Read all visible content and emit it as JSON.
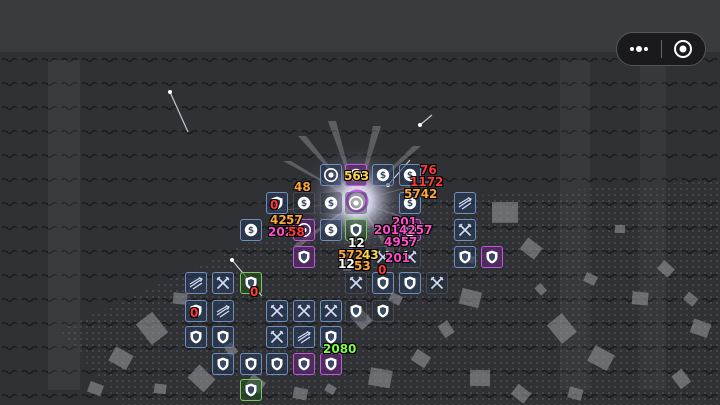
{
  "miniprogram_menu": {
    "more_icon": "more-dots-icon",
    "close_icon": "close-target-icon"
  },
  "colors": {
    "hit_purple": "#ff4fc8",
    "hit_orange": "#ffa63a",
    "hit_red": "#ff3a3a",
    "hit_green": "#7dff4a",
    "hit_gold": "#ffd54a",
    "tile_blue": "#6e8fc0",
    "tile_purple": "#c05ad8",
    "tile_green": "#7fc85a"
  },
  "damage_numbers": [
    {
      "text": "48",
      "color": "#ffa63a"
    },
    {
      "text": "563",
      "color": "#ffd54a"
    },
    {
      "text": "76",
      "color": "#ff3a3a"
    },
    {
      "text": "1172",
      "color": "#ff3a3a"
    },
    {
      "text": "5742",
      "color": "#ffa63a"
    },
    {
      "text": "0",
      "color": "#ff3a3a"
    },
    {
      "text": "422",
      "color": "#ffa63a"
    },
    {
      "text": "57",
      "color": "#ffa63a"
    },
    {
      "text": "2028",
      "color": "#ff4fc8"
    },
    {
      "text": "58",
      "color": "#ff3a3a"
    },
    {
      "text": "201",
      "color": "#ff4fc8"
    },
    {
      "text": "2014257",
      "color": "#ff4fc8"
    },
    {
      "text": "4957",
      "color": "#ff4fc8"
    },
    {
      "text": "12",
      "color": "#ffffff"
    },
    {
      "text": "5724",
      "color": "#ffa63a"
    },
    {
      "text": "43",
      "color": "#ffd54a"
    },
    {
      "text": "12",
      "color": "#ffffff"
    },
    {
      "text": "53",
      "color": "#ffa63a"
    },
    {
      "text": "201",
      "color": "#ff4fc8"
    },
    {
      "text": "0",
      "color": "#ff3a3a"
    },
    {
      "text": "0",
      "color": "#ff3a3a"
    },
    {
      "text": "0",
      "color": "#ff3a3a"
    },
    {
      "text": "2080",
      "color": "#7dff4a"
    }
  ],
  "tiles": [
    {
      "icon": "target-icon",
      "style": "blue"
    },
    {
      "icon": "coin-icon",
      "style": "purple"
    },
    {
      "icon": "coin-icon",
      "style": "blue"
    },
    {
      "icon": "coin-icon",
      "style": "blue"
    },
    {
      "icon": "shield-icon",
      "style": "blue"
    },
    {
      "icon": "coin-icon",
      "style": "dark"
    },
    {
      "icon": "coin-icon",
      "style": "dark"
    },
    {
      "icon": "target-icon",
      "style": "dark"
    },
    {
      "icon": "coin-icon",
      "style": "blue"
    },
    {
      "icon": "arrows-icon",
      "style": "blue"
    },
    {
      "icon": "coin-icon",
      "style": "blue"
    },
    {
      "icon": "target-icon",
      "style": "purple"
    },
    {
      "icon": "coin-icon",
      "style": "blue"
    },
    {
      "icon": "shield-icon",
      "style": "green"
    },
    {
      "icon": "coin-icon",
      "style": "purple"
    },
    {
      "icon": "sword-icon",
      "style": "blue"
    },
    {
      "icon": "shield-icon",
      "style": "purple"
    },
    {
      "icon": "sword-icon",
      "style": "dark"
    },
    {
      "icon": "sword-icon",
      "style": "dark"
    },
    {
      "icon": "shield-icon",
      "style": "blue"
    },
    {
      "icon": "shield-icon",
      "style": "purple"
    },
    {
      "icon": "arrows-icon",
      "style": "blue"
    },
    {
      "icon": "sword-icon",
      "style": "blue"
    },
    {
      "icon": "shield-icon",
      "style": "green"
    },
    {
      "icon": "sword-icon",
      "style": "dark"
    },
    {
      "icon": "shield-icon",
      "style": "blue"
    },
    {
      "icon": "shield-icon",
      "style": "blue"
    },
    {
      "icon": "sword-icon",
      "style": "dark"
    },
    {
      "icon": "shield-icon",
      "style": "blue"
    },
    {
      "icon": "arrows-icon",
      "style": "blue"
    },
    {
      "icon": "sword-icon",
      "style": "blue"
    },
    {
      "icon": "sword-icon",
      "style": "blue"
    },
    {
      "icon": "sword-icon",
      "style": "blue"
    },
    {
      "icon": "shield-icon",
      "style": "dark"
    },
    {
      "icon": "shield-icon",
      "style": "dark"
    },
    {
      "icon": "shield-icon",
      "style": "blue"
    },
    {
      "icon": "shield-icon",
      "style": "blue"
    },
    {
      "icon": "sword-icon",
      "style": "blue"
    },
    {
      "icon": "arrows-icon",
      "style": "blue"
    },
    {
      "icon": "shield-icon",
      "style": "blue"
    },
    {
      "icon": "shield-icon",
      "style": "blue"
    },
    {
      "icon": "shield-icon",
      "style": "blue"
    },
    {
      "icon": "shield-icon",
      "style": "blue"
    },
    {
      "icon": "shield-icon",
      "style": "purple"
    },
    {
      "icon": "shield-icon",
      "style": "purple"
    },
    {
      "icon": "shield-icon",
      "style": "green"
    }
  ]
}
